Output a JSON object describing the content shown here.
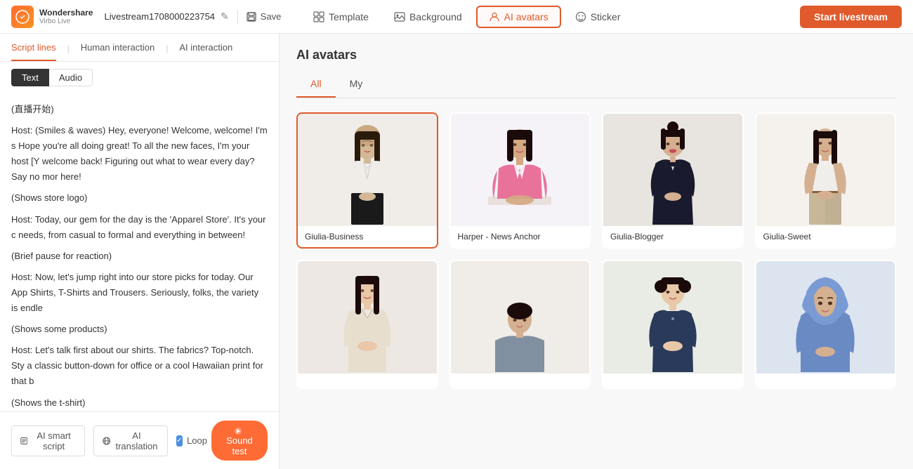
{
  "app": {
    "logo_line1": "Wondershare",
    "logo_line2": "Virbo Live",
    "stream_name": "Livestream1708000223754",
    "save_label": "Save"
  },
  "nav": {
    "template_label": "Template",
    "background_label": "Background",
    "ai_avatars_label": "AI avatars",
    "sticker_label": "Sticker",
    "start_label": "Start livestream"
  },
  "left_panel": {
    "tab_script": "Script lines",
    "tab_human": "Human interaction",
    "tab_ai": "AI interaction",
    "tab_text": "Text",
    "tab_audio": "Audio",
    "script_lines": [
      "(直播开始)",
      "Host: (Smiles & waves) Hey, everyone! Welcome, welcome! I'm s Hope you're all doing great! To all the new faces, I'm your host [Y welcome back! Figuring out what to wear every day? Say no mor here!",
      "(Shows store logo)",
      "Host: Today, our gem for the day is the 'Apparel Store'. It's your c needs, from casual to formal and everything in between!",
      "(Brief pause for reaction)",
      "Host: Now, let's jump right into our store picks for today. Our App Shirts, T-Shirts and Trousers. Seriously, folks, the variety is endle",
      "(Shows some products)",
      "Host: Let's talk first about our shirts. The fabrics? Top-notch. Sty a classic button-down for office or a cool Hawaiian print for that b",
      "(Shows the t-shirt)"
    ],
    "footer_ai_script": "AI smart script",
    "footer_ai_translation": "AI translation",
    "loop_label": "Loop",
    "sound_test_label": "Sound test"
  },
  "right_panel": {
    "title": "AI avatars",
    "filter_all": "All",
    "filter_my": "My",
    "avatars": [
      {
        "id": 1,
        "name": "Giulia-Business",
        "selected": true,
        "bg": "#f0ede8",
        "outfit": "white-shirt-black-pants",
        "hair": "dark-long"
      },
      {
        "id": 2,
        "name": "Harper - News Anchor",
        "selected": false,
        "bg": "#f5f2f8",
        "outfit": "pink-blazer",
        "hair": "dark-long"
      },
      {
        "id": 3,
        "name": "Giulia-Blogger",
        "selected": false,
        "bg": "#f0ede8",
        "outfit": "black-dress",
        "hair": "dark-up"
      },
      {
        "id": 4,
        "name": "Giulia-Sweet",
        "selected": false,
        "bg": "#f5f2ee",
        "outfit": "white-top-beige-pants",
        "hair": "dark-long"
      },
      {
        "id": 5,
        "name": "",
        "selected": false,
        "bg": "#f5f2ee",
        "outfit": "satin-shirt",
        "hair": "dark-long"
      },
      {
        "id": 6,
        "name": "",
        "selected": false,
        "bg": "#f5f2ee",
        "outfit": "casual",
        "hair": "dark-short"
      },
      {
        "id": 7,
        "name": "",
        "selected": false,
        "bg": "#f5f2ee",
        "outfit": "overalls",
        "hair": "dark-buns"
      },
      {
        "id": 8,
        "name": "",
        "selected": false,
        "bg": "#e8edf2",
        "outfit": "blue-hijab",
        "hair": "hijab"
      }
    ]
  }
}
